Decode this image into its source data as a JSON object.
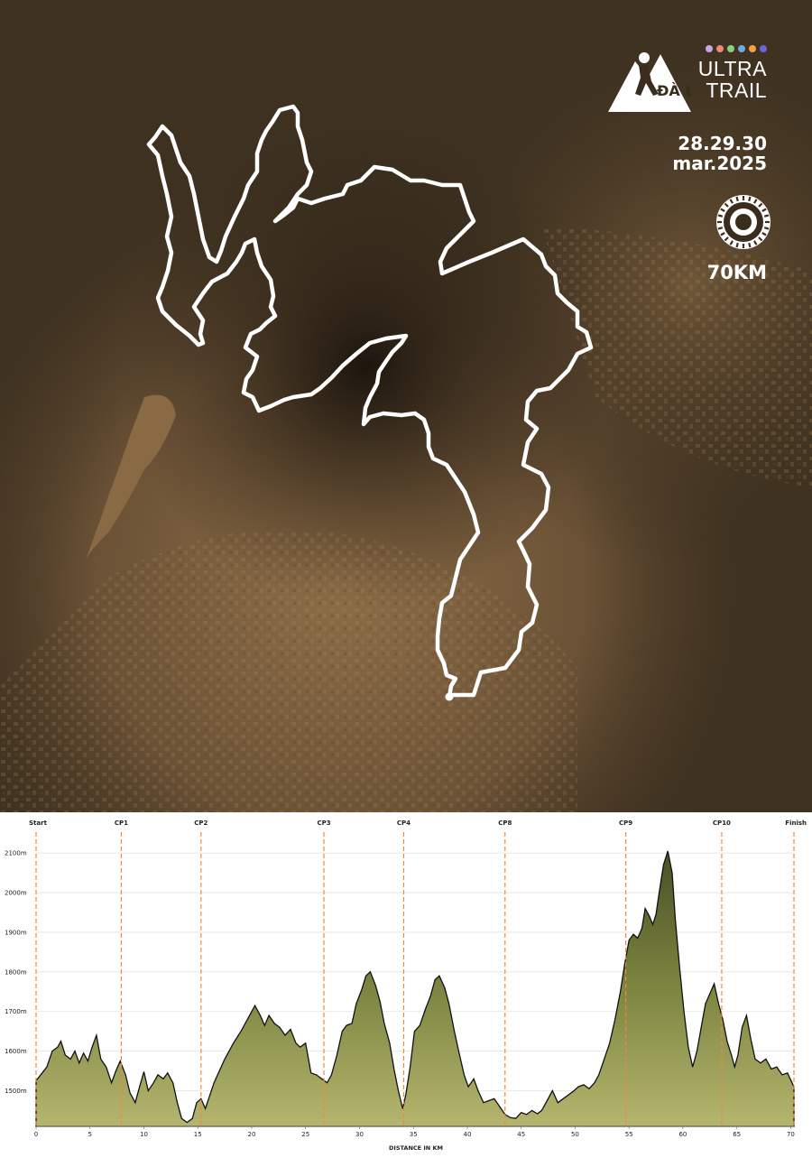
{
  "brand": {
    "logo_letters": "ĐÀ LẠT",
    "ultra": "ULTRA",
    "trail": "TRAIL",
    "dates_line1": "28.29.30",
    "dates_line2": "mar.2025",
    "distance": "70KM",
    "dot_colors": [
      "#c9a6e8",
      "#e98a7a",
      "#8bd17c",
      "#6fa9e6",
      "#f2a343",
      "#6b63d9"
    ]
  },
  "map": {
    "background": "#3e3120",
    "route_color": "#ffffff",
    "lake_color": "#8a6a44"
  },
  "chart_data": {
    "type": "area",
    "xlabel": "DISTANCE IN KM",
    "ylabel": "",
    "xlim": [
      0,
      70.3
    ],
    "ylim": [
      1410,
      2130
    ],
    "x_ticks": [
      0,
      5,
      10,
      15,
      20,
      25,
      30,
      35,
      40,
      45,
      50,
      55,
      60,
      65,
      70
    ],
    "y_ticks": [
      1500,
      1600,
      1700,
      1800,
      1900,
      2000,
      2100
    ],
    "y_tick_labels": [
      "1500m",
      "1600m",
      "1700m",
      "1800m",
      "1900m",
      "2000m",
      "2100m"
    ],
    "checkpoints": [
      {
        "name": "Start",
        "km": 0
      },
      {
        "name": "CP1",
        "km": 7.9
      },
      {
        "name": "CP2",
        "km": 15.3
      },
      {
        "name": "CP3",
        "km": 26.7
      },
      {
        "name": "CP4",
        "km": 34.1
      },
      {
        "name": "CP8",
        "km": 43.5
      },
      {
        "name": "CP9",
        "km": 54.7
      },
      {
        "name": "CP10",
        "km": 63.6
      },
      {
        "name": "Finish",
        "km": 70.3
      }
    ],
    "elevation": {
      "x": [
        0,
        1,
        1.5,
        2,
        2.3,
        2.7,
        3.2,
        3.6,
        4,
        4.4,
        4.8,
        5.2,
        5.6,
        6,
        6.5,
        7,
        7.4,
        7.8,
        8.3,
        8.7,
        9.2,
        9.6,
        10,
        10.4,
        10.9,
        11.3,
        11.8,
        12.2,
        12.7,
        13.1,
        13.5,
        14,
        14.5,
        14.9,
        15.3,
        15.7,
        16.5,
        17.5,
        18.3,
        19,
        19.6,
        20,
        20.3,
        20.8,
        21.2,
        21.6,
        22.1,
        22.6,
        23.1,
        23.6,
        24.1,
        24.5,
        25,
        25.5,
        26,
        26.5,
        27,
        27.4,
        27.9,
        28.4,
        28.8,
        29.3,
        29.7,
        30.2,
        30.6,
        31,
        31.5,
        31.9,
        32.3,
        32.8,
        33.2,
        33.6,
        34,
        34.3,
        34.7,
        35.1,
        35.6,
        36.1,
        36.6,
        37,
        37.4,
        37.9,
        38.3,
        38.8,
        39.2,
        39.7,
        40.1,
        40.6,
        41,
        41.5,
        42,
        42.5,
        43,
        43.5,
        44,
        44.5,
        45,
        45.5,
        46,
        46.5,
        46.9,
        47.4,
        47.9,
        48.4,
        48.9,
        49.4,
        49.9,
        50.3,
        50.8,
        51.3,
        51.8,
        52.2,
        52.7,
        53.2,
        53.7,
        54.2,
        54.6,
        55,
        55.4,
        55.8,
        56.2,
        56.5,
        56.9,
        57.2,
        57.5,
        57.8,
        58.2,
        58.6,
        59,
        59.3,
        59.7,
        60.1,
        60.5,
        60.9,
        61.3,
        61.7,
        62.1,
        62.5,
        62.9,
        63.3,
        63.7,
        64.1,
        64.5,
        64.8,
        65.1,
        65.5,
        65.9,
        66.3,
        66.7,
        67.2,
        67.7,
        68.2,
        68.7,
        69.2,
        69.7,
        70.3
      ],
      "y": [
        1525,
        1560,
        1600,
        1610,
        1625,
        1590,
        1580,
        1600,
        1570,
        1595,
        1575,
        1610,
        1640,
        1580,
        1560,
        1520,
        1550,
        1575,
        1540,
        1495,
        1470,
        1510,
        1548,
        1500,
        1520,
        1540,
        1530,
        1545,
        1520,
        1470,
        1430,
        1420,
        1430,
        1470,
        1480,
        1455,
        1520,
        1580,
        1620,
        1650,
        1680,
        1700,
        1715,
        1690,
        1665,
        1690,
        1670,
        1660,
        1640,
        1655,
        1620,
        1610,
        1620,
        1545,
        1540,
        1530,
        1520,
        1540,
        1590,
        1650,
        1665,
        1670,
        1720,
        1755,
        1790,
        1800,
        1765,
        1725,
        1670,
        1620,
        1555,
        1500,
        1455,
        1490,
        1560,
        1650,
        1665,
        1705,
        1740,
        1780,
        1790,
        1760,
        1720,
        1650,
        1600,
        1540,
        1510,
        1530,
        1500,
        1470,
        1475,
        1480,
        1460,
        1440,
        1432,
        1430,
        1445,
        1440,
        1450,
        1442,
        1450,
        1475,
        1500,
        1470,
        1480,
        1490,
        1500,
        1510,
        1515,
        1505,
        1520,
        1540,
        1580,
        1620,
        1680,
        1750,
        1820,
        1880,
        1895,
        1885,
        1910,
        1960,
        1940,
        1920,
        1945,
        2000,
        2070,
        2105,
        2050,
        1930,
        1810,
        1700,
        1610,
        1560,
        1600,
        1660,
        1720,
        1745,
        1770,
        1720,
        1680,
        1625,
        1590,
        1560,
        1590,
        1660,
        1690,
        1630,
        1580,
        1570,
        1580,
        1555,
        1560,
        1540,
        1545,
        1510,
        1525,
        1515
      ]
    }
  }
}
